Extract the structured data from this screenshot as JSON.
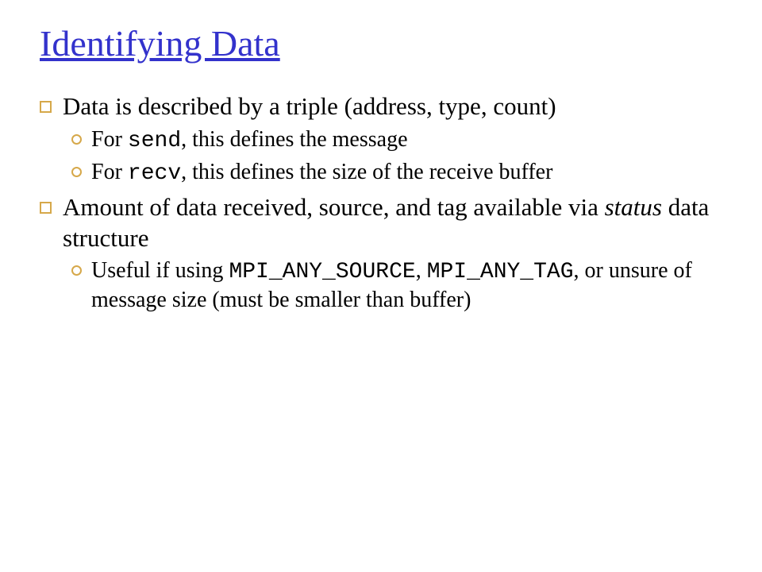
{
  "title": "Identifying Data",
  "b1": {
    "pre": "Data is described by a triple (address, type, count)"
  },
  "b1a": {
    "pre": "For ",
    "code": "send",
    "post": ", this defines the message"
  },
  "b1b": {
    "pre": "For ",
    "code": "recv",
    "post": ", this defines the size of the receive buffer"
  },
  "b2": {
    "pre": "Amount of data received, source, and tag available via ",
    "italic": "status",
    "post": " data structure"
  },
  "b2a": {
    "pre": "Useful if using ",
    "code1": "MPI_ANY_SOURCE",
    "mid": ", ",
    "code2": "MPI_ANY_TAG",
    "post": ", or unsure of message size (must be smaller than buffer)"
  }
}
